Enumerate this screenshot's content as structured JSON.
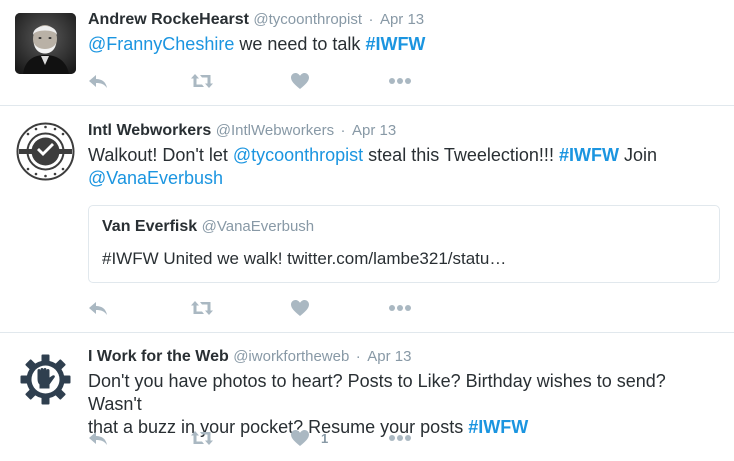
{
  "tweets": [
    {
      "fullname": "Andrew RockeHearst",
      "username": "@tycoonthropist",
      "sep": "·",
      "time": "Apr 13",
      "avatar_icon": "portrait-photo",
      "text": {
        "p1": "@FrannyCheshire",
        "p2": " we need to talk ",
        "p3": "#IWFW"
      },
      "like_count": ""
    },
    {
      "fullname": "Intl Webworkers",
      "username": "@IntlWebworkers",
      "sep": "·",
      "time": "Apr 13",
      "avatar_icon": "union-seal-logo",
      "avatar_text_top": "INTERNATIONAL WEB",
      "avatar_text_bottom": "WORKERS",
      "text": {
        "p1": "Walkout! Don't let ",
        "p2": "@tycoonthropist",
        "p3": " steal this Tweelection!!! ",
        "p4": "#IWFW",
        "p5": " Join",
        "p6": "@VanaEverbush"
      },
      "quote": {
        "fullname": "Van Everfisk",
        "username": "@VanaEverbush",
        "text": "#IWFW United we walk! twitter.com/lambe321/statu…"
      },
      "like_count": ""
    },
    {
      "fullname": "I Work for the Web",
      "username": "@iworkfortheweb",
      "sep": "·",
      "time": "Apr 13",
      "avatar_icon": "gear-fist-logo",
      "text": {
        "p1": "Don't you have photos to heart? Posts to Like? Birthday wishes to send? Wasn't",
        "p2": "that a buzz in your pocket? Resume your posts ",
        "p3": "#IWFW"
      },
      "like_count": "1"
    }
  ],
  "colors": {
    "link": "#1b95e0",
    "meta": "#8899a6",
    "icon": "#aab8c2",
    "divider": "#e1e8ed"
  }
}
